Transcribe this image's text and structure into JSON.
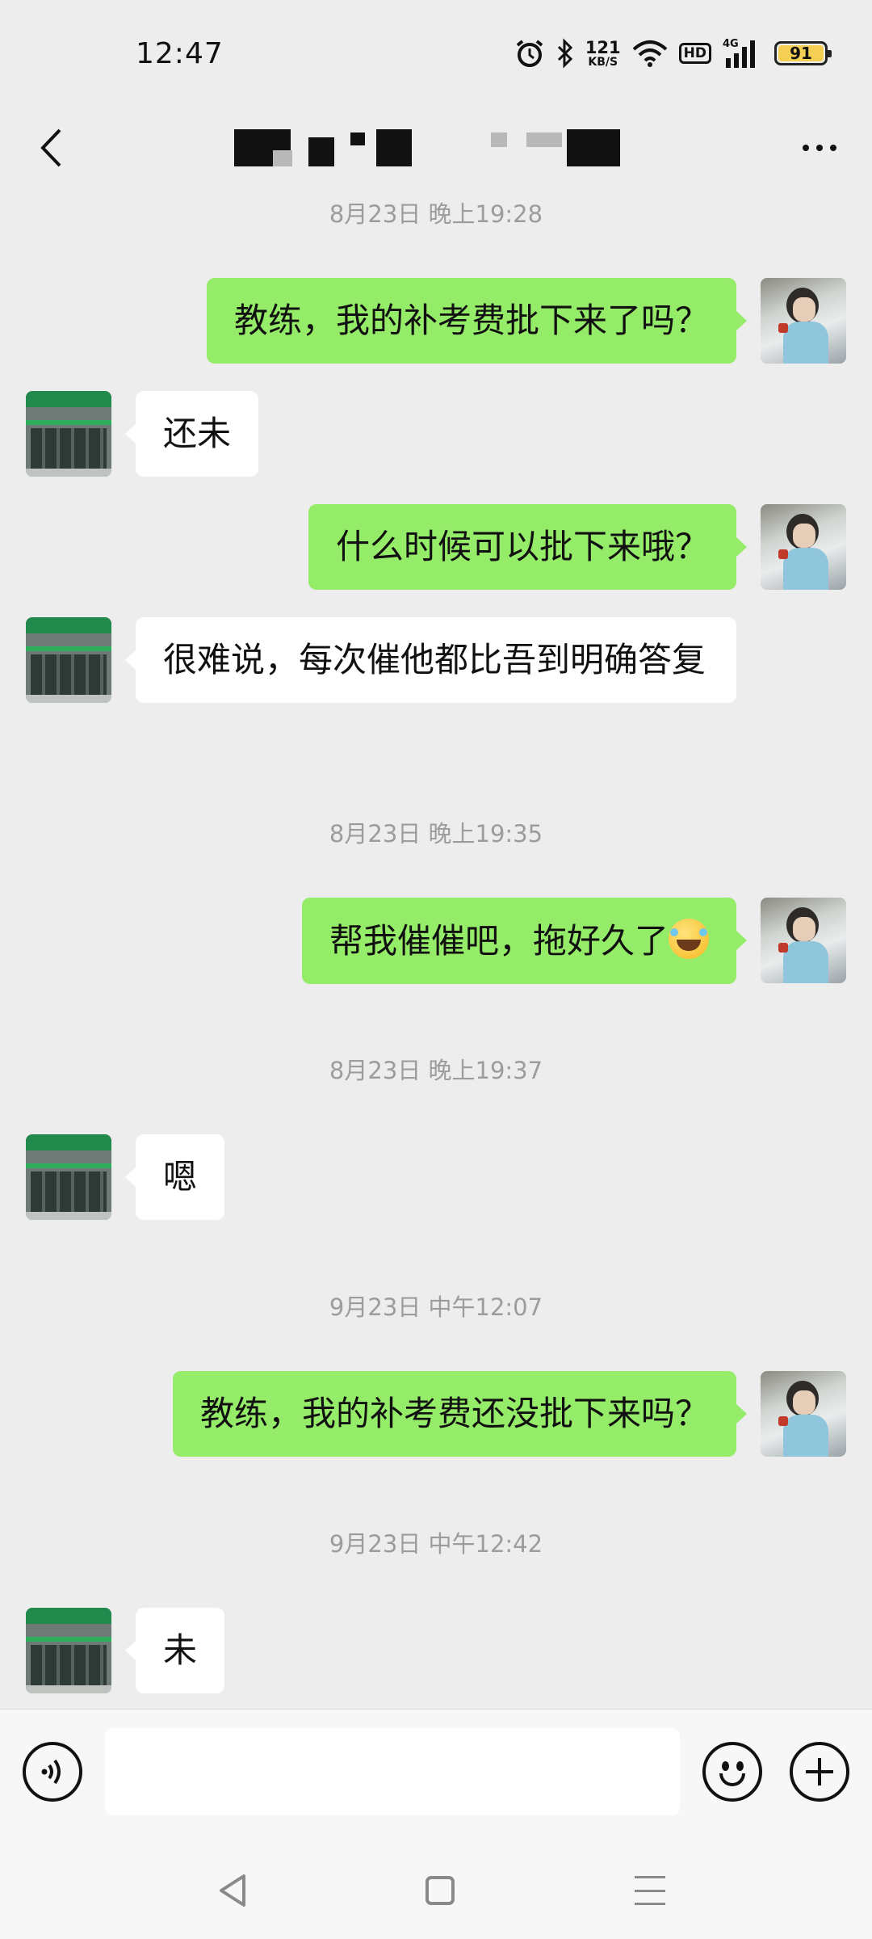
{
  "status_bar": {
    "time": "12:47",
    "net_speed_value": "121",
    "net_speed_unit": "KB/S",
    "hd_badge": "HD",
    "network": "4G",
    "battery": "91",
    "icons": [
      "alarm-icon",
      "bluetooth-icon",
      "wifi-icon",
      "signal-icon",
      "battery-icon"
    ]
  },
  "header": {
    "back_icon": "chevron-left-icon",
    "title": "",
    "more_icon": "more-dots-icon"
  },
  "chat": {
    "timestamps": [
      "8月23日 晚上19:28",
      "8月23日 晚上19:35",
      "8月23日 晚上19:37",
      "9月23日 中午12:07",
      "9月23日 中午12:42"
    ],
    "messages": [
      {
        "from": "me",
        "text": "教练，我的补考费批下来了吗？"
      },
      {
        "from": "them",
        "text": "还未"
      },
      {
        "from": "me",
        "text": "什么时候可以批下来哦？"
      },
      {
        "from": "them",
        "text": "很难说，每次催他都比吾到明确答复"
      },
      {
        "from": "me",
        "text": "帮我催催吧，拖好久了",
        "emoji": "laughing-tears-emoji"
      },
      {
        "from": "them",
        "text": "嗯"
      },
      {
        "from": "me",
        "text": "教练，我的补考费还没批下来吗？"
      },
      {
        "from": "them",
        "text": "未"
      }
    ]
  },
  "input_bar": {
    "voice_icon": "voice-icon",
    "input_value": "",
    "emoji_icon": "emoji-icon",
    "plus_icon": "plus-icon"
  },
  "colors": {
    "sent_bubble": "#95ec69",
    "received_bubble": "#ffffff",
    "chat_background": "#ededed"
  }
}
